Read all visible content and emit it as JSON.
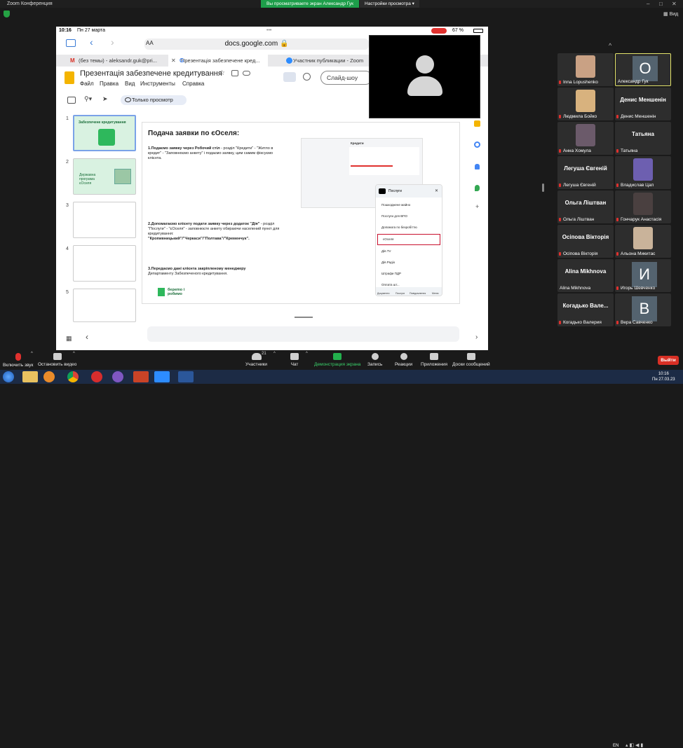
{
  "zoom": {
    "title": "Zoom Конференция",
    "banner": "Вы просматриваете экран Александр Гук",
    "view_options": "Настройки просмотра",
    "view_label": "Вид"
  },
  "ipad": {
    "time": "10:16",
    "date": "Пн 27 марта",
    "battery": "67 %",
    "url": "docs.google.com",
    "aa": "AA",
    "tabs": [
      "(без темы) - aleksandr.guk@pri...",
      "Презентація забезпечене кред...",
      "Участник публикации - Zoom"
    ],
    "doc_title": "Презентація забезпечене кредитування",
    "menu": [
      "Файл",
      "Правка",
      "Вид",
      "Инструменты",
      "Справка"
    ],
    "slideshow": "Слайд-шоу",
    "view_only": "Только просмотр",
    "thumb_numbers": [
      "1",
      "2",
      "3",
      "4",
      "5"
    ],
    "thumb1_text": "Забезпечене кредитування",
    "thumb2_text": "Державна програма єОселя",
    "slide": {
      "heading": "Подача заявки по єОселя:",
      "p1a": "1.Подаємо заявку через Робочий стіл",
      "p1b": " - розділ \"Кредити\" - \"Житло в кредит\" - \"Заповнюємо анкету\" і подаємо заявку, цим самим фіксуємо клієнта.",
      "p2a": "2.Допомагаємо клієнту подати заявку через додаток \"Дія\"",
      "p2b": " - розділ \"Послуги\" - \"єОселя\" - заповнюєте анкету обираючи населений пункт для кредитування:",
      "p2c": "\"Кропивницький\"/\"Черкаси\"/\"Полтава\"/\"Кременчук\".",
      "p3a": "3.Передаємо дані клієнта закріпленому менеджеру",
      "p3b": "Департаменту Забезпеченого кредитування.",
      "logo": "берemo і робимо",
      "phone_title": "Послуги",
      "phone_items": [
        "Пошкоджене майно",
        "Послуги для ВПО",
        "Допомога по безробіттю",
        "єОселя",
        "Дія.TV",
        "Дія.Радіо",
        "Штрафи ПДР",
        "Оплата шт..."
      ],
      "phone_nav": [
        "Документи",
        "Послуги",
        "Повідомлення",
        "Меню"
      ],
      "crm_title": "Кредити"
    }
  },
  "participants": [
    {
      "name": "Inna Lopushenko",
      "type": "photo",
      "color": "#c9a184"
    },
    {
      "name": "Александр Гук",
      "type": "letter",
      "letter": "О",
      "active": true
    },
    {
      "name": "Людмила Бойко",
      "type": "photo",
      "color": "#d8b27e"
    },
    {
      "name": "Денис Меншенін",
      "type": "name"
    },
    {
      "name": "Анна Хомула",
      "type": "photo",
      "color": "#6b5a6a"
    },
    {
      "name": "Татьяна",
      "type": "name"
    },
    {
      "name": "Легуша Євгеній",
      "type": "name"
    },
    {
      "name": "Владислав Цап",
      "type": "photo",
      "color": "#6d5fb0"
    },
    {
      "name": "Ольга Ліштван",
      "type": "name"
    },
    {
      "name": "Гончарук Анастасія",
      "type": "photo",
      "color": "#4a4040"
    },
    {
      "name": "Осіпова Вікторія",
      "type": "name"
    },
    {
      "name": "Альона Микитас",
      "type": "photo",
      "color": "#c9b39a"
    },
    {
      "name": "Alina Mikhnova",
      "type": "name"
    },
    {
      "name": "Игорь Шевченко",
      "type": "letter",
      "letter": "И"
    },
    {
      "name": "Когадько Вале...",
      "sub": "Когадько Валерия",
      "type": "name"
    },
    {
      "name": "Вера Савченко",
      "type": "letter",
      "letter": "В"
    }
  ],
  "bottom": {
    "mute": "Включить звук",
    "video": "Остановить видео",
    "participants": "Участники",
    "participants_count": "21",
    "chat": "Чат",
    "share": "Демонстрация экрана",
    "record": "Запись",
    "reactions": "Реакции",
    "apps": "Приложения",
    "whiteboard": "Доски сообщений",
    "leave": "Выйти"
  },
  "taskbar": {
    "lang": "EN",
    "time": "10:16",
    "date": "Пн 27.03.23"
  }
}
